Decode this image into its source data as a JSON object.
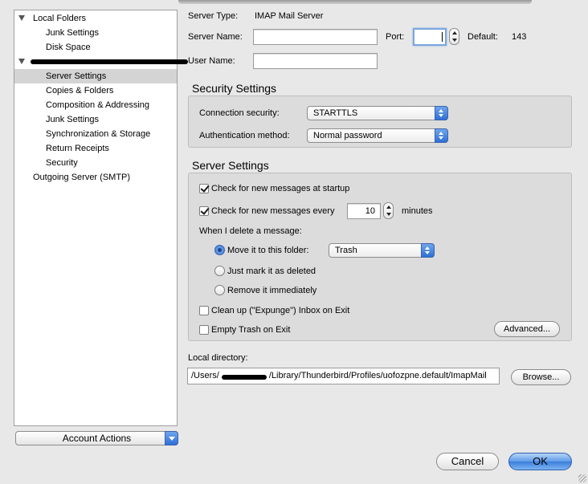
{
  "tree": {
    "items": [
      {
        "label": "Local Folders"
      },
      {
        "label": "Junk Settings"
      },
      {
        "label": "Disk Space"
      },
      {
        "label": ""
      },
      {
        "label": "Server Settings"
      },
      {
        "label": "Copies & Folders"
      },
      {
        "label": "Composition & Addressing"
      },
      {
        "label": "Junk Settings"
      },
      {
        "label": "Synchronization & Storage"
      },
      {
        "label": "Return Receipts"
      },
      {
        "label": "Security"
      },
      {
        "label": "Outgoing Server (SMTP)"
      }
    ]
  },
  "account_actions": {
    "label": "Account Actions"
  },
  "server": {
    "type_label": "Server Type:",
    "type_value": "IMAP Mail Server",
    "name_label": "Server Name:",
    "name_value": "",
    "port_label": "Port:",
    "port_value": "",
    "default_label": "Default:",
    "default_value": "143",
    "user_label": "User Name:",
    "user_value": ""
  },
  "security": {
    "title": "Security Settings",
    "connection_label": "Connection security:",
    "connection_value": "STARTTLS",
    "auth_label": "Authentication method:",
    "auth_value": "Normal password"
  },
  "server_settings": {
    "title": "Server Settings",
    "check_startup": {
      "label": "Check for new messages at startup",
      "checked": true
    },
    "check_every": {
      "label": "Check for new messages every",
      "checked": true,
      "value": "10",
      "unit": "minutes"
    },
    "delete_label": "When I delete a message:",
    "move_label": "Move it to this folder:",
    "move_folder": "Trash",
    "mark_label": "Just mark it as deleted",
    "remove_label": "Remove it immediately",
    "selected_delete_option": "move",
    "expunge": {
      "label": "Clean up (\"Expunge\") Inbox on Exit",
      "checked": false
    },
    "empty_trash": {
      "label": "Empty Trash on Exit",
      "checked": false
    },
    "advanced_label": "Advanced..."
  },
  "local_directory": {
    "label": "Local directory:",
    "path_prefix": "/Users/",
    "path_suffix": "/Library/Thunderbird/Profiles/uofozpne.default/ImapMail",
    "browse_label": "Browse..."
  },
  "dialog": {
    "cancel_label": "Cancel",
    "ok_label": "OK"
  },
  "colors": {
    "accent": "#3b7fdc",
    "selected_row": "#d4d4d4",
    "window_bg": "#e8e8e8"
  }
}
